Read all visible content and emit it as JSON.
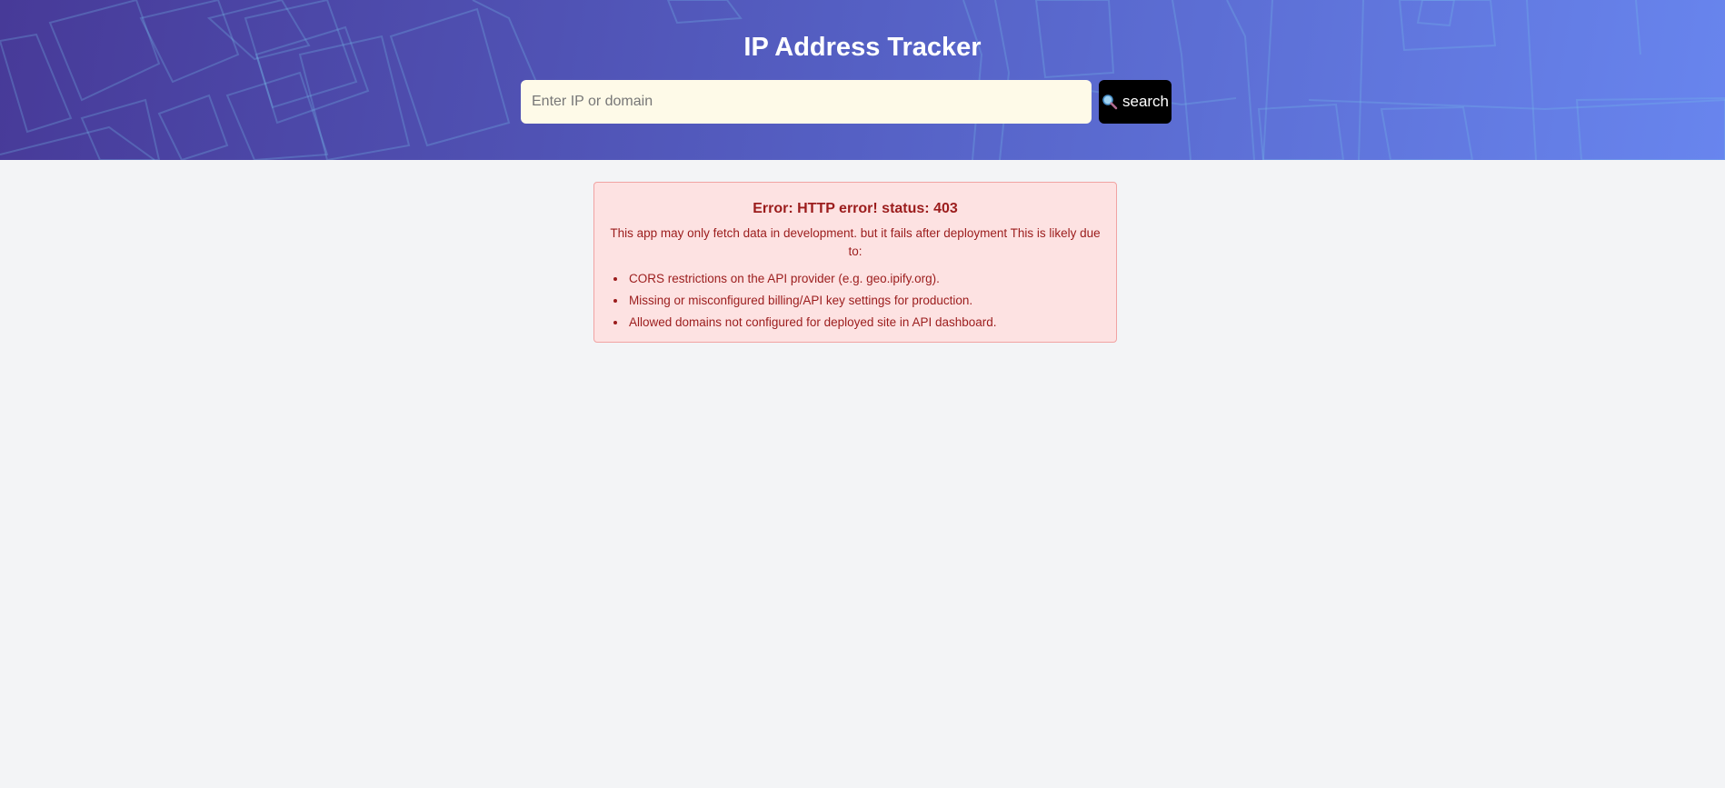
{
  "header": {
    "title": "IP Address Tracker",
    "search": {
      "placeholder": "Enter IP or domain",
      "value": "",
      "button_label": "search",
      "button_icon": "magnifying-glass-icon"
    },
    "colors": {
      "gradient_start": "#473a98",
      "gradient_end": "#6885ee",
      "input_background": "#fefae8",
      "button_background": "#000000"
    }
  },
  "error": {
    "title": "Error: HTTP error! status: 403",
    "description": "This app may only fetch data in development. but it fails after deployment This is likely due to:",
    "reasons": [
      "CORS restrictions on the API provider (e.g. geo.ipify.org).",
      "Missing or misconfigured billing/API key settings for production.",
      "Allowed domains not configured for deployed site in API dashboard."
    ],
    "colors": {
      "background": "#fde2e2",
      "border": "#f1a3a3",
      "text": "#9b1c1c"
    }
  },
  "page": {
    "background": "#f3f4f6"
  }
}
